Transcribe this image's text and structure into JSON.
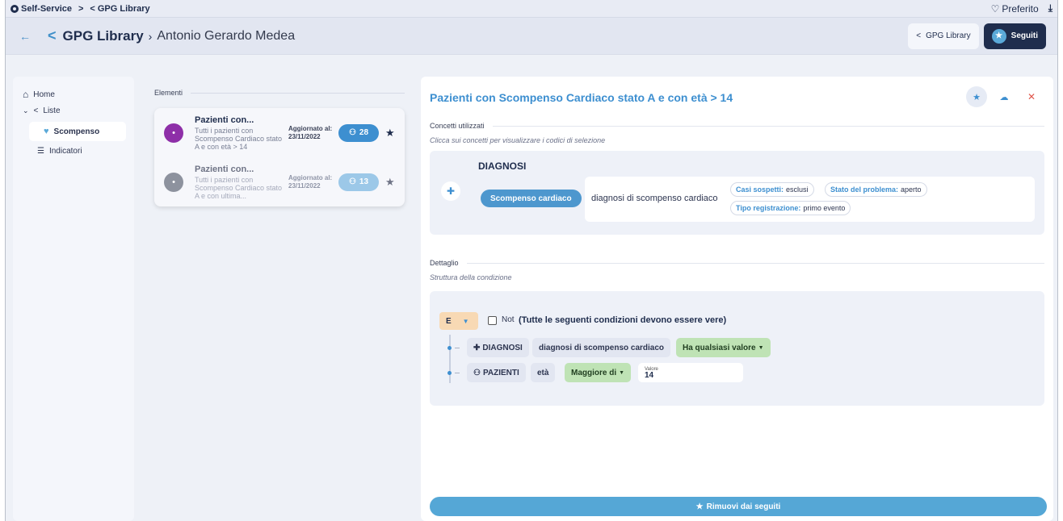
{
  "topbar": {
    "crumb1": "Self-Service",
    "crumb2": "GPG Library",
    "favorite": "Preferito"
  },
  "header": {
    "title": "GPG Library",
    "subtitle": "Antonio Gerardo Medea",
    "tab_library": "GPG Library",
    "tab_followed": "Seguiti"
  },
  "sidebar": {
    "home": "Home",
    "liste": "Liste",
    "scompenso": "Scompenso",
    "indicatori": "Indicatori"
  },
  "list": {
    "section_label": "Elementi",
    "items": [
      {
        "name": "Pazienti con...",
        "desc": "Tutti i pazienti con Scompenso Cardiaco stato A e con età > 14",
        "updated_label": "Aggiornato al:",
        "updated_date": "23/11/2022",
        "count": "28",
        "avatar_color": "#8e2fa8"
      },
      {
        "name": "Pazienti con...",
        "desc": "Tutti i pazienti con Scompenso Cardiaco stato A e con ultima...",
        "updated_label": "Aggiornato al:",
        "updated_date": "23/11/2022",
        "count": "13",
        "avatar_color": "#8d929e"
      }
    ]
  },
  "detail": {
    "title": "Pazienti con Scompenso Cardiaco stato A e con età > 14",
    "concepts_label": "Concetti utilizzati",
    "concepts_hint": "Clicca sui concetti per visualizzare i codici di selezione",
    "diagnosis": {
      "heading": "DIAGNOSI",
      "pill": "Scompenso cardiaco",
      "description": "diagnosi di scompenso cardiaco",
      "tags": [
        {
          "key": "Casi sospetti:",
          "value": "esclusi"
        },
        {
          "key": "Stato del problema:",
          "value": "aperto"
        },
        {
          "key": "Tipo registrazione:",
          "value": "primo evento"
        }
      ]
    },
    "detail_label": "Dettaglio",
    "detail_hint": "Struttura della condizione",
    "condition": {
      "operator": "E",
      "not_label": "Not",
      "description": "(Tutte le seguenti condizioni devono essere vere)",
      "row1": {
        "entity": "DIAGNOSI",
        "field": "diagnosi di scompenso cardiaco",
        "operator": "Ha qualsiasi valore"
      },
      "row2": {
        "entity": "PAZIENTI",
        "field": "età",
        "operator": "Maggiore di",
        "value_label": "Valore",
        "value": "14"
      }
    },
    "remove_button": "Rimuovi dai seguiti"
  }
}
